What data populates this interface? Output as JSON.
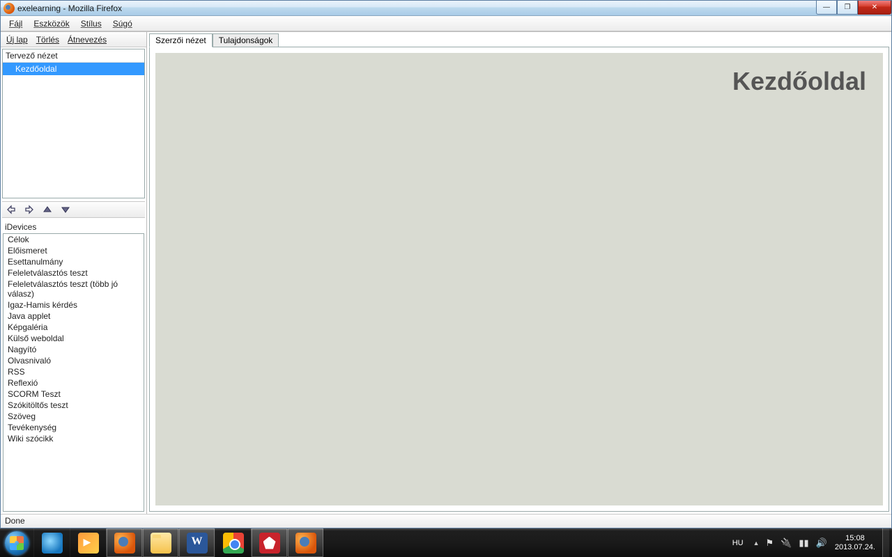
{
  "window": {
    "title": "exelearning - Mozilla Firefox"
  },
  "menubar": [
    "Fájl",
    "Eszközök",
    "Stílus",
    "Súgó"
  ],
  "page_actions": [
    "Új lap",
    "Törlés",
    "Átnevezés"
  ],
  "outline": {
    "header": "Tervező nézet",
    "selected_item": "Kezdőoldal"
  },
  "nav_arrows": [
    "promote",
    "demote",
    "up",
    "down"
  ],
  "idevices_label": "iDevices",
  "idevices": [
    "Célok",
    "Előismeret",
    "Esettanulmány",
    "Feleletválasztós teszt",
    "Feleletválasztós teszt (több jó válasz)",
    "Igaz-Hamis kérdés",
    "Java applet",
    "Képgaléria",
    "Külső weboldal",
    "Nagyító",
    "Olvasnivaló",
    "RSS",
    "Reflexió",
    "SCORM Teszt",
    "Szókitöltős teszt",
    "Szöveg",
    "Tevékenység",
    "Wiki szócikk"
  ],
  "tabs": [
    {
      "label": "Szerzői nézet",
      "active": true
    },
    {
      "label": "Tulajdonságok",
      "active": false
    }
  ],
  "page_heading": "Kezdőoldal",
  "status": "Done",
  "tray": {
    "lang": "HU",
    "time": "15:08",
    "date": "2013.07.24."
  }
}
